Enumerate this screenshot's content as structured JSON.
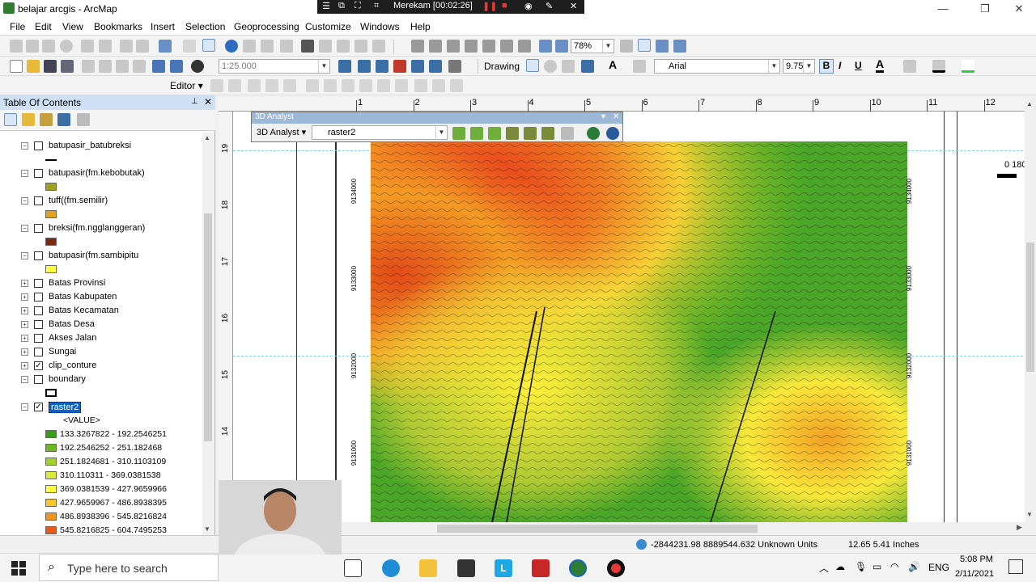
{
  "app": {
    "title": "belajar arcgis - ArcMap",
    "window_controls": [
      "—",
      "❐",
      "✕"
    ]
  },
  "recording": {
    "label": "Merekam [00:02:26]"
  },
  "menubar": {
    "items": [
      "File",
      "Edit",
      "View",
      "Bookmarks",
      "Insert",
      "Selection",
      "Geoprocessing",
      "Customize",
      "Windows",
      "Help"
    ]
  },
  "toolbar1": {
    "zoom_value": "78%"
  },
  "toolbar2": {
    "scale_value": "1:25.000",
    "drawing_label": "Drawing",
    "font_value": "Arial",
    "font_size_value": "9.75",
    "bold_label": "B",
    "italic_label": "I",
    "underline_label": "U"
  },
  "toolbar3": {
    "editor_label": "Editor"
  },
  "toc": {
    "title": "Table Of Contents",
    "pin_label": "⊥",
    "close_label": "✕",
    "layers": [
      {
        "label": "batupasir_batubreksi",
        "expand": "−",
        "checked": false,
        "swatch_type": "line"
      },
      {
        "label": "batupasir(fm.kebobutak)",
        "expand": "−",
        "checked": false,
        "swatch_color": "#a0a020"
      },
      {
        "label": "tuff((fm.semilir)",
        "expand": "−",
        "checked": false,
        "swatch_color": "#e0a020"
      },
      {
        "label": "breksi(fm.ngglanggeran)",
        "expand": "−",
        "checked": false,
        "swatch_color": "#7a2a10"
      },
      {
        "label": "batupasir(fm.sambipitu",
        "expand": "−",
        "checked": false,
        "swatch_color": "#ffff40"
      },
      {
        "label": "Batas Provinsi",
        "expand": "+",
        "checked": false
      },
      {
        "label": "Batas Kabupaten",
        "expand": "+",
        "checked": false
      },
      {
        "label": "Batas Kecamatan",
        "expand": "+",
        "checked": false
      },
      {
        "label": "Batas Desa",
        "expand": "+",
        "checked": false
      },
      {
        "label": "Akses Jalan",
        "expand": "+",
        "checked": false
      },
      {
        "label": "Sungai",
        "expand": "+",
        "checked": false
      },
      {
        "label": "clip_conture",
        "expand": "+",
        "checked": true
      },
      {
        "label": "boundary",
        "expand": "−",
        "checked": false,
        "swatch_type": "hollow"
      },
      {
        "label": "raster2",
        "expand": "−",
        "checked": true,
        "selected": true
      }
    ],
    "raster_value_header": "<VALUE>",
    "raster_classes": [
      {
        "label": "133.3267822 - 192.2546251",
        "color": "#3a9a1a"
      },
      {
        "label": "192.2546252 - 251.182468",
        "color": "#6cb81e"
      },
      {
        "label": "251.1824681 - 310.1103109",
        "color": "#a5d22a"
      },
      {
        "label": "310.110311 - 369.0381538",
        "color": "#d9ea3a"
      },
      {
        "label": "369.0381539 - 427.9659966",
        "color": "#ffff3c"
      },
      {
        "label": "427.9659967 - 486.8938395",
        "color": "#f7c62a"
      },
      {
        "label": "486.8938396 - 545.8216824",
        "color": "#f29420"
      },
      {
        "label": "545.8216825 - 604.7495253",
        "color": "#e85a18"
      }
    ]
  },
  "analyst3d": {
    "window_title": "3D Analyst",
    "menu_label": "3D Analyst",
    "layer_value": "raster2"
  },
  "map": {
    "ruler_top": [
      "1",
      "2",
      "3",
      "4",
      "5",
      "6",
      "7",
      "8",
      "9",
      "10",
      "11",
      "12"
    ],
    "ruler_left": [
      "19",
      "18",
      "17",
      "16",
      "15",
      "14"
    ],
    "northings": [
      "9134000",
      "9133000",
      "9132000",
      "9131000"
    ],
    "scalebar_label": "0 180"
  },
  "status": {
    "coords": "-2844231.98  8889544.632 Unknown Units",
    "page_coords": "12.65  5.41 Inches"
  },
  "taskbar": {
    "search_placeholder": "Type here to search",
    "language": "ENG",
    "time": "5:08 PM",
    "date": "2/11/2021"
  }
}
